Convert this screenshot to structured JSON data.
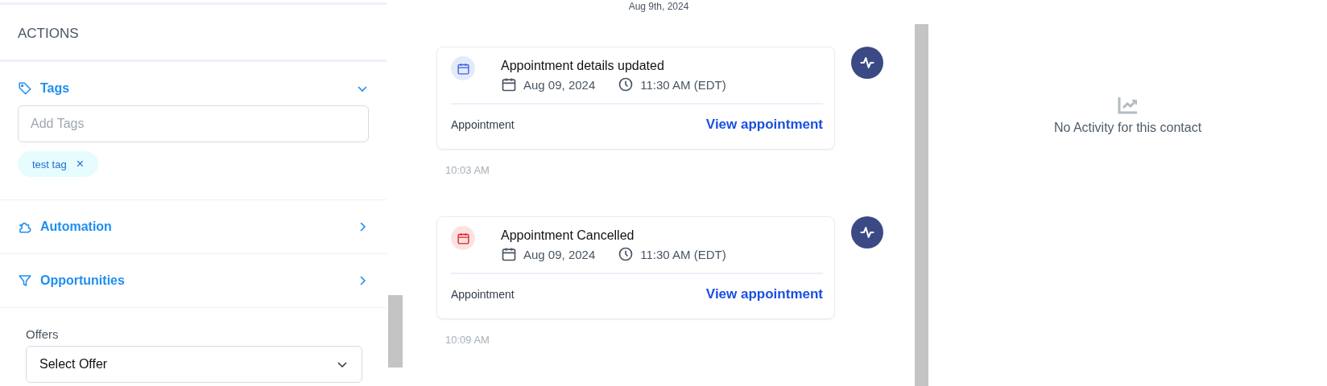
{
  "actions_panel": {
    "title": "ACTIONS",
    "sections": [
      {
        "kind": "tags",
        "label": "Tags",
        "expanded": true,
        "input": {
          "placeholder": "Add Tags"
        },
        "tags": [
          {
            "label": "test tag",
            "remove": "×"
          }
        ]
      },
      {
        "kind": "automation",
        "label": "Automation",
        "expanded": false
      },
      {
        "kind": "opportunities",
        "label": "Opportunities",
        "expanded": false
      }
    ],
    "offers": {
      "label": "Offers",
      "select": "Select Offer"
    }
  },
  "timeline": {
    "date": "Aug 9th, 2024",
    "events": [
      {
        "title": "Appointment details updated",
        "color": "#3b63e0",
        "date": "Aug 09, 2024",
        "time": "11:30 AM (EDT)",
        "type": "Appointment",
        "link": "View appointment",
        "timestamp": "10:03 AM"
      },
      {
        "title": "Appointment Cancelled",
        "color": "#e02424",
        "date": "Aug 09, 2024",
        "time": "11:30 AM (EDT)",
        "type": "Appointment",
        "link": "View appointment",
        "timestamp": "10:09 AM"
      }
    ]
  },
  "activity_panel": {
    "empty_message": "No Activity for this contact"
  }
}
